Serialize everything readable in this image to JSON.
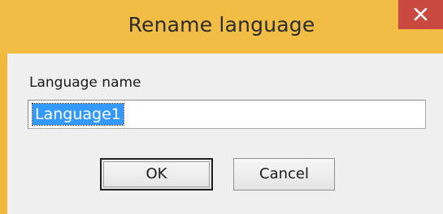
{
  "dialog": {
    "title": "Rename language",
    "close_icon": "close-icon",
    "field_label": "Language name",
    "input_value": "Language1",
    "ok_label": "OK",
    "cancel_label": "Cancel"
  },
  "colors": {
    "titlebar": "#f2bd45",
    "close_button": "#c9483f",
    "selection": "#3399ff",
    "client_bg": "#f0f0f0"
  }
}
